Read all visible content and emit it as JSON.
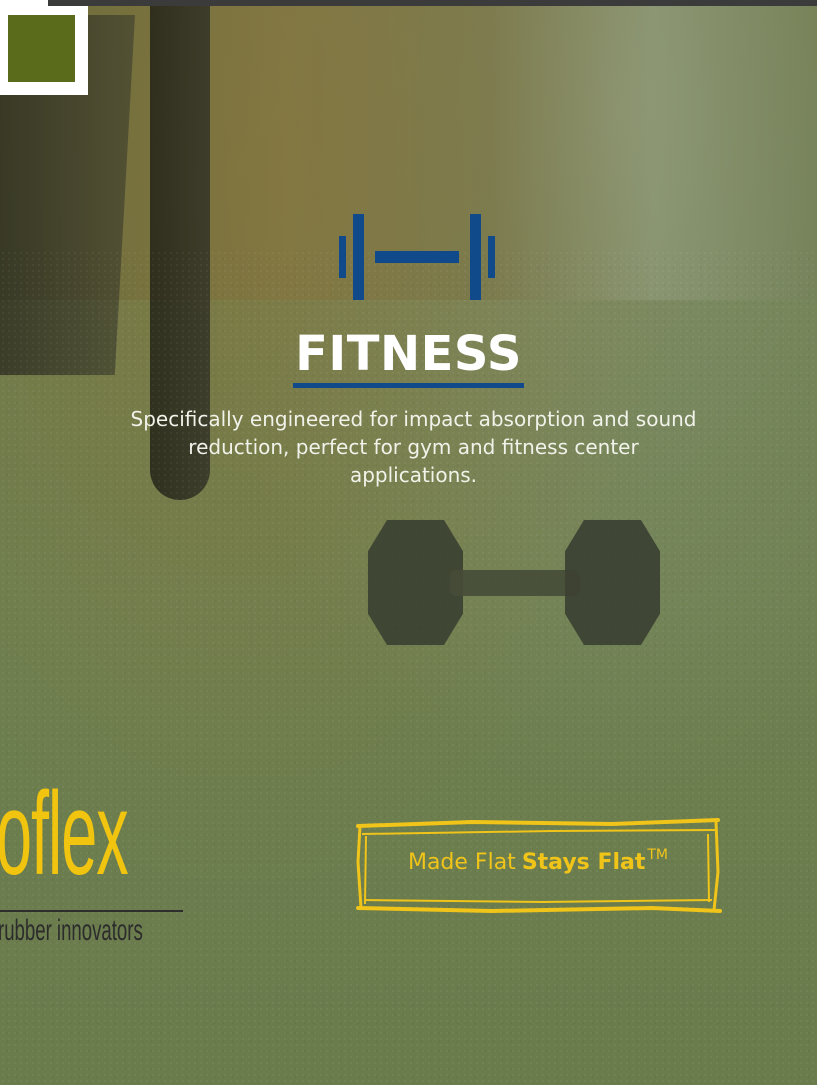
{
  "section": {
    "icon": "dumbbell-icon",
    "title": "FITNESS",
    "description": "Specifically engineered for impact absorption and sound reduction, perfect for gym and fitness center applications."
  },
  "brand": {
    "logo_word": "oflex",
    "tagline": "rubber innovators"
  },
  "badge": {
    "text_light": "Made Flat",
    "text_bold": "Stays Flat",
    "trademark": "TM"
  },
  "colors": {
    "accent_blue": "#104a8a",
    "brand_yellow": "#f0c419",
    "corner_green": "#5a6b1b",
    "overlay_green": "#6d7d4e"
  }
}
